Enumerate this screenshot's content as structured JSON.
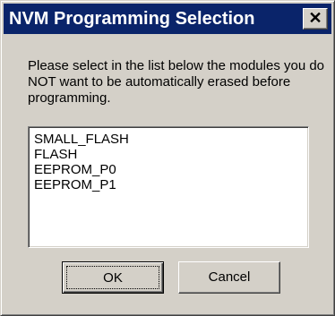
{
  "window": {
    "title": "NVM Programming Selection",
    "close_symbol": "✕"
  },
  "message": "Please select in the list below the modules you do NOT want to be automatically erased before programming.",
  "modules": [
    {
      "label": "SMALL_FLASH"
    },
    {
      "label": "FLASH"
    },
    {
      "label": "EEPROM_P0"
    },
    {
      "label": "EEPROM_P1"
    }
  ],
  "buttons": {
    "ok_label": "OK",
    "cancel_label": "Cancel"
  },
  "colors": {
    "title_bar": "#0a246a",
    "title_text": "#ffffff",
    "dialog_face": "#d4d0c8",
    "list_background": "#ffffff"
  }
}
